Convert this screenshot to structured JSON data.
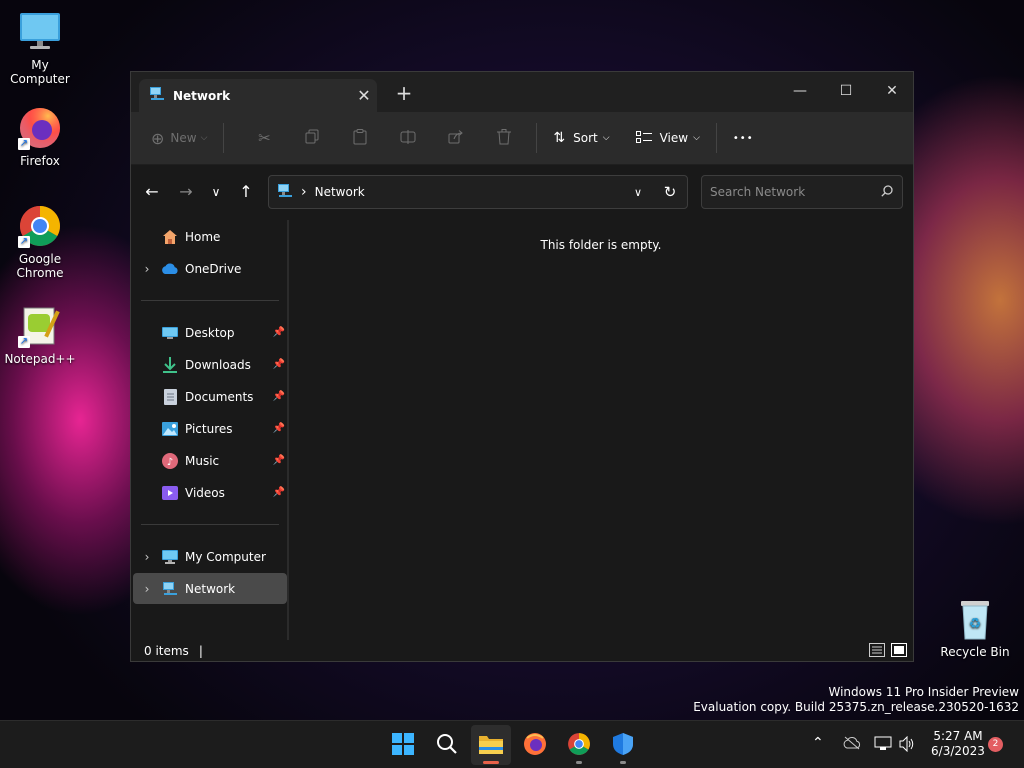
{
  "desktop": {
    "icons": [
      {
        "label": "My Computer"
      },
      {
        "label": "Firefox"
      },
      {
        "label": "Google Chrome"
      },
      {
        "label": "Notepad++"
      },
      {
        "label": "Recycle Bin"
      }
    ]
  },
  "window": {
    "tab_title": "Network",
    "tab_close": "✕",
    "new_tab": "+",
    "controls": {
      "minimize": "—",
      "maximize": "☐",
      "close": "✕"
    },
    "toolbar": {
      "new_label": "New",
      "sort_label": "Sort",
      "view_label": "View",
      "more_label": "•••"
    },
    "address": {
      "breadcrumb_sep": "›",
      "location": "Network",
      "search_placeholder": "Search Network"
    },
    "nav": {
      "home": "Home",
      "onedrive": "OneDrive",
      "desktop": "Desktop",
      "downloads": "Downloads",
      "documents": "Documents",
      "pictures": "Pictures",
      "music": "Music",
      "videos": "Videos",
      "mycomputer": "My Computer",
      "network": "Network"
    },
    "content": {
      "empty_message": "This folder is empty."
    },
    "status": {
      "items": "0 items",
      "cursor": "|"
    }
  },
  "watermark": {
    "line1": "Windows 11 Pro Insider Preview",
    "line2": "Evaluation copy. Build 25375.zn_release.230520-1632"
  },
  "taskbar": {
    "time": "5:27 AM",
    "date": "6/3/2023",
    "notification_count": "2"
  },
  "colors": {
    "accent": "#0078d4",
    "window_bg": "#191919",
    "toolbar_bg": "#2b2b2b",
    "selected_nav": "#4a4a4a",
    "badge": "#e35e62"
  }
}
